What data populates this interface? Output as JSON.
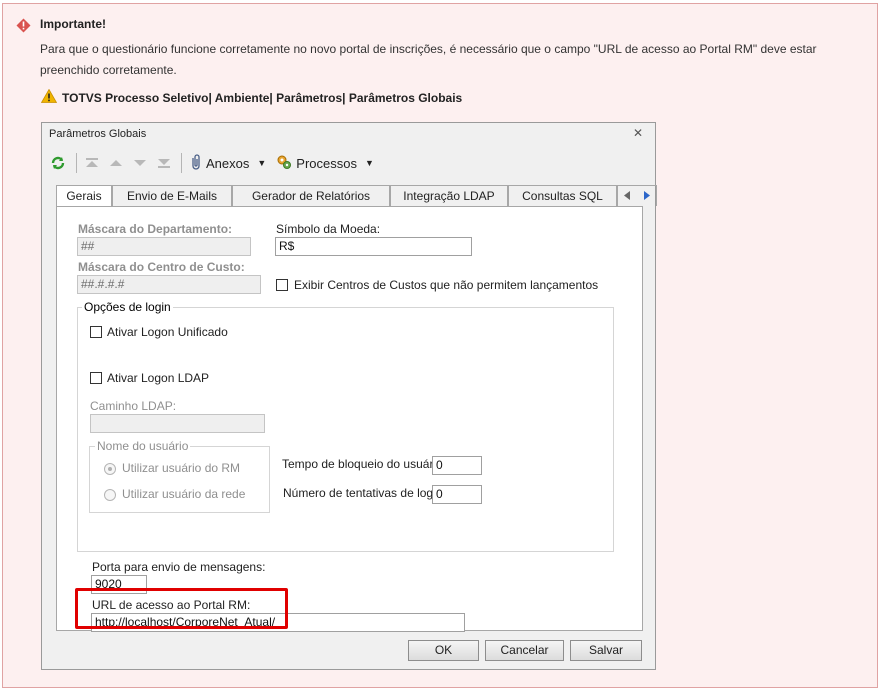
{
  "alert": {
    "title": "Importante!",
    "text": "Para que o questionário funcione corretamente no novo portal de inscrições, é necessário que o campo \"URL de acesso ao Portal RM\" deve estar preenchido corretamente.",
    "path": "TOTVS Processo Seletivo| Ambiente| Parâmetros| Parâmetros Globais",
    "icon": "error-icon",
    "warning_icon": "warning-icon",
    "accent_color": "#d9534f"
  },
  "window": {
    "title": "Parâmetros Globais",
    "close": "✕",
    "toolbar": {
      "attachments_label": "Anexos",
      "processes_label": "Processos"
    },
    "tabs": [
      "Gerais",
      "Envio de E-Mails",
      "Gerador de Relatórios",
      "Integração LDAP",
      "Consultas SQL"
    ],
    "fields": {
      "dept_mask_label": "Máscara do Departamento:",
      "dept_mask_value": "##",
      "currency_label": "Símbolo da Moeda:",
      "currency_value": "R$",
      "cost_center_mask_label": "Máscara do Centro de Custo:",
      "cost_center_mask_value": "##.#.#.#",
      "show_cost_centers_label": "Exibir Centros de Custos que não permitem lançamentos",
      "login_options_legend": "Opções de login",
      "unified_logon_label": "Ativar Logon Unificado",
      "ldap_logon_label": "Ativar Logon LDAP",
      "ldap_path_label": "Caminho LDAP:",
      "ldap_path_value": "",
      "username_legend": "Nome do usuário",
      "use_rm_user_label": "Utilizar usuário do RM",
      "use_network_user_label": "Utilizar usuário da rede",
      "lock_time_label": "Tempo de bloqueio do usuário:",
      "lock_time_value": "0",
      "login_attempts_label": "Número de tentativas de login:",
      "login_attempts_value": "0",
      "messages_port_label": "Porta para envio de mensagens:",
      "messages_port_value": "9020",
      "portal_url_label": "URL de acesso ao Portal RM:",
      "portal_url_value": "http://localhost/CorporeNet_Atual/"
    },
    "buttons": {
      "ok": "OK",
      "cancel": "Cancelar",
      "save": "Salvar"
    }
  }
}
